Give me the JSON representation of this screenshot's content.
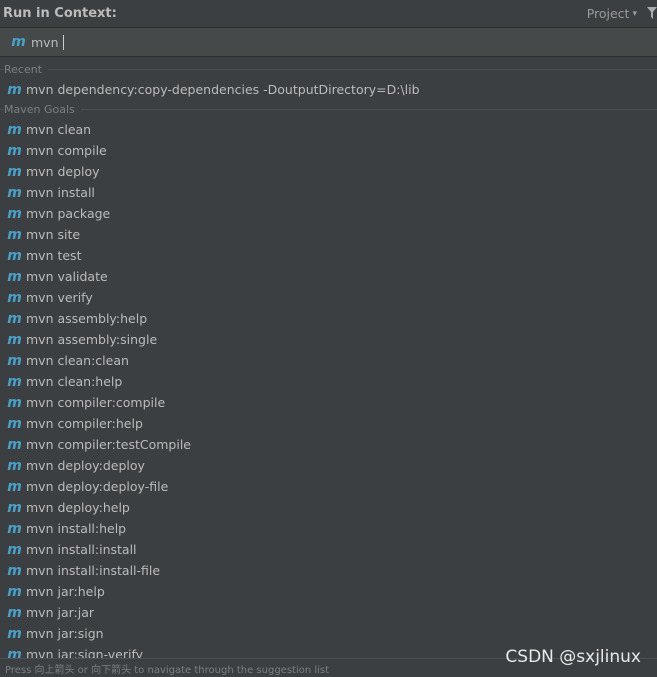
{
  "header": {
    "title": "Run in Context:",
    "project_label": "Project",
    "chevron": "⌄"
  },
  "search": {
    "icon": "m",
    "value": "mvn"
  },
  "recent": {
    "label": "Recent",
    "items": [
      {
        "icon": "m",
        "label": "mvn dependency:copy-dependencies -DoutputDirectory=D:\\lib"
      }
    ]
  },
  "maven_goals": {
    "label": "Maven Goals",
    "items": [
      {
        "icon": "m",
        "label": "mvn clean"
      },
      {
        "icon": "m",
        "label": "mvn compile"
      },
      {
        "icon": "m",
        "label": "mvn deploy"
      },
      {
        "icon": "m",
        "label": "mvn install"
      },
      {
        "icon": "m",
        "label": "mvn package"
      },
      {
        "icon": "m",
        "label": "mvn site"
      },
      {
        "icon": "m",
        "label": "mvn test"
      },
      {
        "icon": "m",
        "label": "mvn validate"
      },
      {
        "icon": "m",
        "label": "mvn verify"
      },
      {
        "icon": "m",
        "label": "mvn assembly:help"
      },
      {
        "icon": "m",
        "label": "mvn assembly:single"
      },
      {
        "icon": "m",
        "label": "mvn clean:clean"
      },
      {
        "icon": "m",
        "label": "mvn clean:help"
      },
      {
        "icon": "m",
        "label": "mvn compiler:compile"
      },
      {
        "icon": "m",
        "label": "mvn compiler:help"
      },
      {
        "icon": "m",
        "label": "mvn compiler:testCompile"
      },
      {
        "icon": "m",
        "label": "mvn deploy:deploy"
      },
      {
        "icon": "m",
        "label": "mvn deploy:deploy-file"
      },
      {
        "icon": "m",
        "label": "mvn deploy:help"
      },
      {
        "icon": "m",
        "label": "mvn install:help"
      },
      {
        "icon": "m",
        "label": "mvn install:install"
      },
      {
        "icon": "m",
        "label": "mvn install:install-file"
      },
      {
        "icon": "m",
        "label": "mvn jar:help"
      },
      {
        "icon": "m",
        "label": "mvn jar:jar"
      },
      {
        "icon": "m",
        "label": "mvn jar:sign"
      },
      {
        "icon": "m",
        "label": "mvn jar:sign-verify"
      }
    ]
  },
  "footer": {
    "hint": "Press 向上箭头 or 向下箭头 to navigate through the suggestion list"
  },
  "watermark": {
    "text": "CSDN @sxjlinux"
  },
  "colors": {
    "background": "#3c3f41",
    "search_background": "#45494a",
    "text": "#bbbbbb",
    "muted_text": "#7c7f82",
    "maven_icon": "#4aa0c8"
  }
}
